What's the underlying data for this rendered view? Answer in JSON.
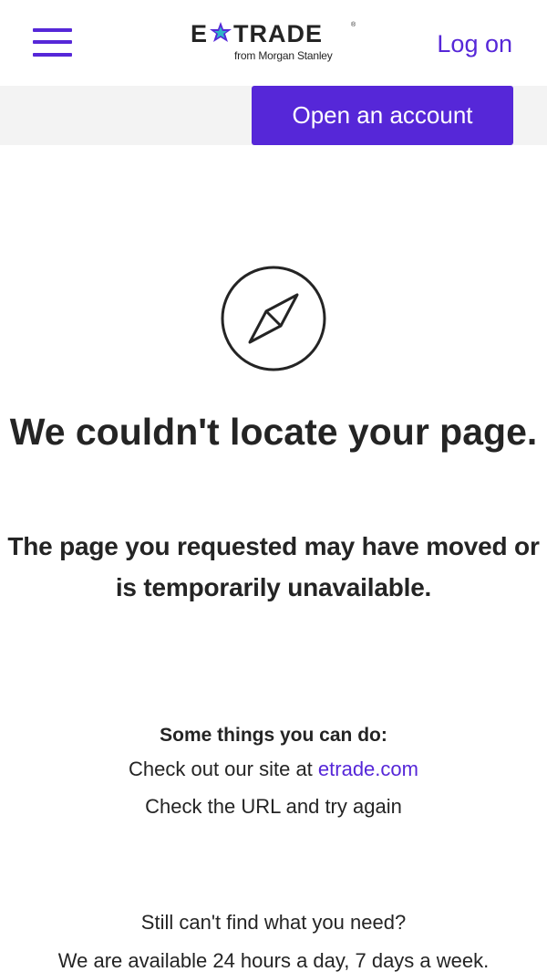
{
  "header": {
    "logo_text_left": "E",
    "logo_text_right": "TRADE",
    "logo_trademark": "®",
    "logo_subtitle": "from Morgan Stanley",
    "login_label": "Log on"
  },
  "cta": {
    "open_account_label": "Open an account"
  },
  "error": {
    "headline": "We couldn't locate your page.",
    "subhead": "The page you requested may have moved or is temporarily unavailable."
  },
  "suggestions": {
    "title": "Some things you can do:",
    "line1_prefix": "Check out our site at ",
    "line1_link": "etrade.com",
    "line2": "Check the URL and try again"
  },
  "support": {
    "line1": "Still can't find what you need?",
    "line2": "We are available 24 hours a day, 7 days a week."
  },
  "colors": {
    "accent": "#5627d8",
    "text": "#242424",
    "bar_background": "#f3f3f3"
  },
  "icons": {
    "menu": "hamburger-menu-icon",
    "logo_mark": "etrade-star-icon",
    "error": "compass-icon"
  }
}
